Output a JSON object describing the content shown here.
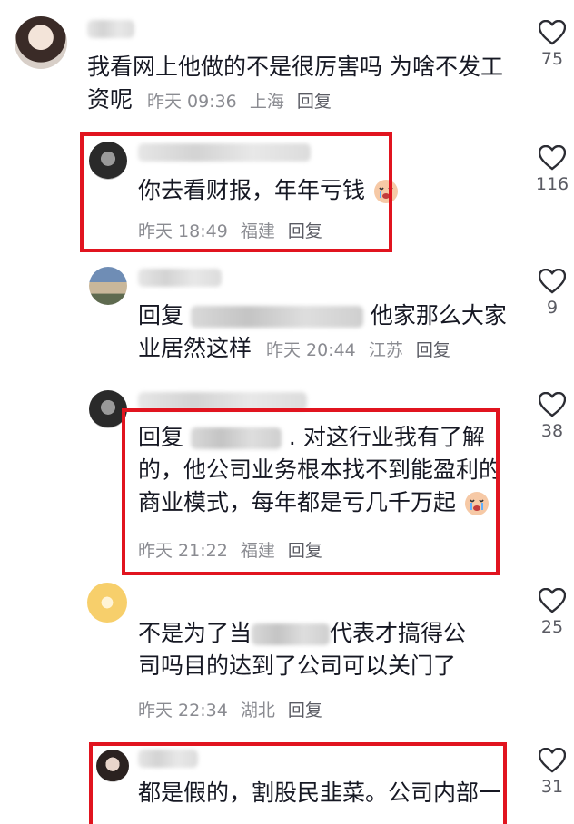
{
  "comments": [
    {
      "text": "我看网上他做的不是很厉害吗 为啥不发工资呢",
      "line1": "我看网上他做的不是很厉害吗 为啥不发工",
      "line2_prefix": "资呢",
      "time": "昨天 09:36",
      "location": "上海",
      "reply_label": "回复",
      "likes": "75"
    },
    {
      "text_line1": "你去看财报，年年亏钱",
      "time": "昨天 18:49",
      "location": "福建",
      "reply_label": "回复",
      "likes": "116",
      "emoji": "crying-face"
    },
    {
      "reply_word": "回复",
      "line1_suffix": "他家那么大家",
      "line2": "业居然这样",
      "time": "昨天 20:44",
      "location": "江苏",
      "reply_label": "回复",
      "likes": "9"
    },
    {
      "reply_word": "回复",
      "line1_suffix": ". 对这行业我有了解",
      "line2": "的，他公司业务根本找不到能盈利的",
      "line3": "商业模式，每年都是亏几千万起",
      "time": "昨天 21:22",
      "location": "福建",
      "reply_label": "回复",
      "likes": "38",
      "emoji": "crying-face"
    },
    {
      "line1_prefix": "不是为了当",
      "line1_suffix": "代表才搞得公",
      "line2": "司吗目的达到了公司可以关门了",
      "time": "昨天 22:34",
      "location": "湖北",
      "reply_label": "回复",
      "likes": "25"
    },
    {
      "line1": "都是假的，割股民韭菜。公司内部一",
      "likes": "31"
    }
  ],
  "colors": {
    "highlight": "#e1141f",
    "meta": "#8a8b91"
  }
}
